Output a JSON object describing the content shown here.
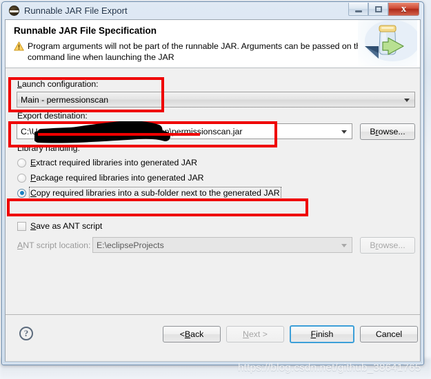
{
  "window": {
    "title": "Runnable JAR File Export",
    "icon": "eclipse-icon",
    "minimize_label": "",
    "maximize_label": "",
    "close_label": "x"
  },
  "banner": {
    "title": "Runnable JAR File Specification",
    "message": "Program arguments will not be part of the runnable JAR. Arguments can be passed on the command line when launching the JAR",
    "warning_icon": "warning-triangle-icon",
    "art_icon": "jar-export-icon"
  },
  "launch": {
    "label_prefix": "L",
    "label": "aunch configuration:",
    "value": "Main - permessionscan"
  },
  "destination": {
    "label": "Export destination:",
    "value": "C:\\Users\\",
    "value_tail": "esktop\\permissionscan.jar",
    "browse_prefix": "B",
    "browse_mnemonic": "r",
    "browse_suffix": "owse..."
  },
  "library": {
    "label": "Library handling:",
    "options": [
      {
        "prefix": "",
        "mnemonic": "E",
        "text": "xtract required libraries into generated JAR",
        "selected": false
      },
      {
        "prefix": "",
        "mnemonic": "P",
        "text": "ackage required libraries into generated JAR",
        "selected": false
      },
      {
        "prefix": "",
        "mnemonic": "C",
        "text": "opy required libraries into a sub-folder next to the generated JAR",
        "selected": true
      }
    ]
  },
  "ant": {
    "checkbox_mnemonic": "S",
    "checkbox_label": "ave as ANT script",
    "checked": false,
    "location_mnemonic": "A",
    "location_label": "NT script location:",
    "location_value": "E:\\eclipseProjects",
    "browse_prefix": "B",
    "browse_mnemonic": "r",
    "browse_suffix": "owse..."
  },
  "footer": {
    "help_label": "?",
    "buttons": [
      {
        "prefix": "< ",
        "mnemonic": "B",
        "suffix": "ack",
        "disabled": false,
        "default": false
      },
      {
        "prefix": "",
        "mnemonic": "N",
        "suffix": "ext >",
        "disabled": true,
        "default": false
      },
      {
        "prefix": "",
        "mnemonic": "F",
        "suffix": "inish",
        "disabled": false,
        "default": true
      },
      {
        "prefix": "",
        "mnemonic": "",
        "suffix": "Cancel",
        "disabled": false,
        "default": false
      }
    ]
  },
  "watermark": {
    "text": "https://blog.csdn.net/github_38641765"
  },
  "colors": {
    "annotation_red": "#ef0000",
    "redaction_black": "#000000",
    "default_button_focus": "#3c9fd8",
    "radio_selected": "#1a7fc1"
  }
}
